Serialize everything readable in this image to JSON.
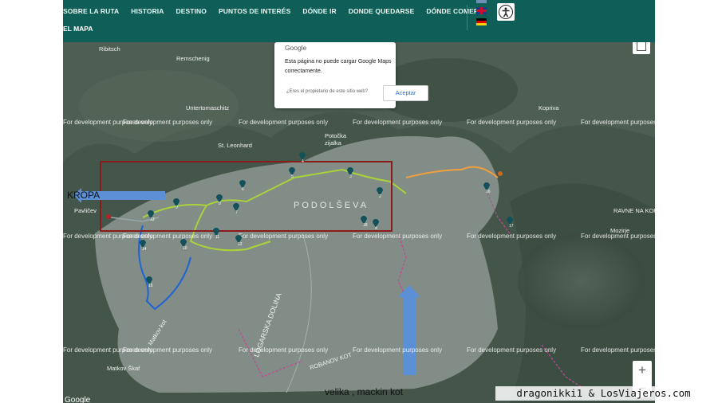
{
  "nav": {
    "items": [
      "SOBRE LA RUTA",
      "HISTORIA",
      "DESTINO",
      "PUNTOS DE INTERÉS",
      "DÓNDE IR",
      "DONDE QUEDARSE",
      "DÓNDE COMER"
    ],
    "sub": "EL MAPA"
  },
  "google_dialog": {
    "logo": "Google",
    "message": "Esta página no puede cargar Google Maps correctamente.",
    "question": "¿Eres el propietario de este sitio web?",
    "button": "Aceptar"
  },
  "map": {
    "places": [
      "Ribitsch",
      "Remschenig",
      "Untertomaschitz",
      "St. Leonhard",
      "Potočka zijalka",
      "Kopriva",
      "RAVNE NA KOROŠKEM",
      "Mozirje",
      "Pavličev",
      "Matkov kot",
      "LOGARSKA DOLINA",
      "ROBANOV KOT",
      "Matkov Škaf"
    ],
    "dev_text": "For development purposes only",
    "area_label": "PODOLŠEVA",
    "markers": [
      "1",
      "2",
      "3",
      "4",
      "5",
      "6",
      "7",
      "8",
      "9",
      "10",
      "11",
      "12",
      "13",
      "14",
      "15",
      "16",
      "17",
      "18"
    ],
    "google_attribution": "Google",
    "zoom_in": "+",
    "zoom_out": "−"
  },
  "annotations": {
    "left_arrow_label": "KROPA",
    "bottom_label": "velika , mackin kot"
  },
  "watermark": "dragonikki1 & LosViajeros.com",
  "colors": {
    "header": "#0f5f58",
    "route_green": "#a9d33a",
    "route_blue": "#1e63d6",
    "route_orange": "#f2a03b",
    "route_pink": "#e0307d",
    "arrow_blue": "#5b8fd6",
    "box_red": "#8b1a1a"
  }
}
